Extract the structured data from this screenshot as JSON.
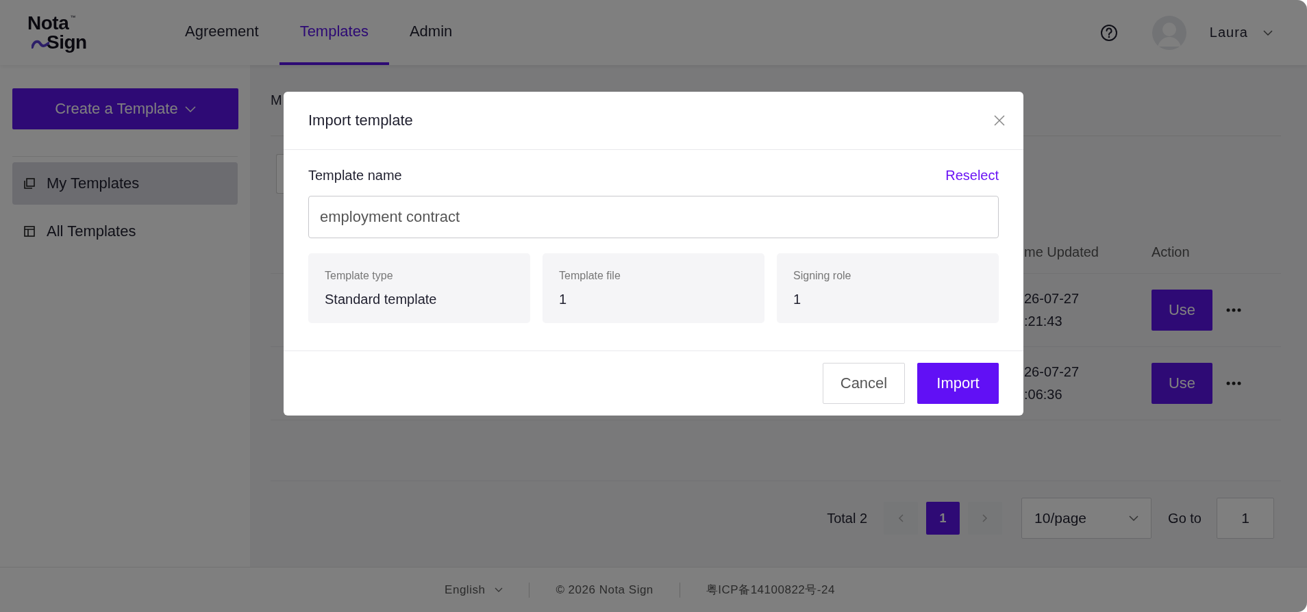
{
  "logo": {
    "word_top": "Nota",
    "word_bottom": "Sign",
    "trademark": "™"
  },
  "nav": [
    {
      "label": "Agreement",
      "selected": false
    },
    {
      "label": "Templates",
      "selected": true
    },
    {
      "label": "Admin",
      "selected": false
    }
  ],
  "user": {
    "name": "Laura"
  },
  "sidebar": {
    "create_button": "Create a Template",
    "items": [
      {
        "label": "My Templates",
        "selected": true,
        "kind": "mine"
      },
      {
        "label": "All Templates",
        "selected": false,
        "kind": "all"
      }
    ]
  },
  "page_heading": "M",
  "table": {
    "columns": [
      "me Updated",
      "Action"
    ],
    "rows": [
      {
        "time_updated": [
          "26-07-27",
          ":21:43"
        ],
        "action": "Use"
      },
      {
        "time_updated": [
          "26-07-27",
          ":06:36"
        ],
        "action": "Use"
      }
    ]
  },
  "pagination": {
    "total": "Total 2",
    "pages": [
      {
        "label": "1",
        "selected": true
      }
    ],
    "page_size": "10/page",
    "goto_label": "Go to",
    "goto_value": "1"
  },
  "footer": {
    "language": "English",
    "copyright": "© 2026 Nota Sign",
    "icp": "粤ICP备14100822号-24"
  },
  "dialog": {
    "title": "Import template",
    "name_label": "Template name",
    "reselect": "Reselect",
    "name_value": "employment contract",
    "info": [
      {
        "label": "Template type",
        "value": "Standard template"
      },
      {
        "label": "Template file",
        "value": "1"
      },
      {
        "label": "Signing role",
        "value": "1"
      }
    ],
    "buttons": [
      {
        "label": "Cancel",
        "kind": "secondary"
      },
      {
        "label": "Import",
        "kind": "primary"
      }
    ]
  }
}
